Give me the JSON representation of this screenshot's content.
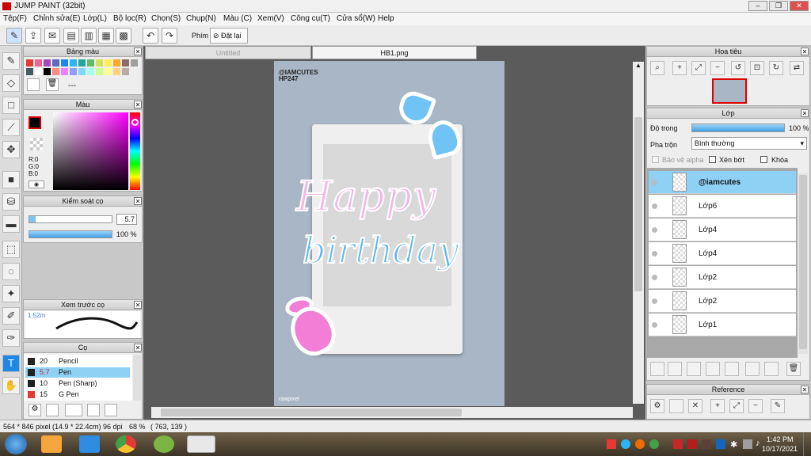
{
  "window": {
    "title": "JUMP PAINT (32bit)"
  },
  "menu": [
    "Tệp(F)",
    "Chỉnh sửa(E)",
    "Lớp(L)",
    "Bộ lọc(R)",
    "Chọn(S)",
    "Chụp(N)",
    "Màu (C)",
    "Xem(V)",
    "Công cụ(T)",
    "Cửa sổ(W)",
    "Help"
  ],
  "toolbar": {
    "phim_label": "Phím",
    "reset_label": "Đặt lại"
  },
  "tabs": {
    "untitled": "Untitled",
    "active": "HB1.png"
  },
  "palette": {
    "title": "Bảng màu",
    "name": "---",
    "colors": [
      "#e53935",
      "#f06292",
      "#ab47bc",
      "#5c6bc0",
      "#1e88e5",
      "#29b6f6",
      "#26a69a",
      "#66bb6a",
      "#d4e157",
      "#ffee58",
      "#ffa726",
      "#8d6e63",
      "#9e9e9e",
      "#455a64",
      "#ffffff",
      "#000000",
      "#ff8a80",
      "#ea80fc",
      "#8c9eff",
      "#80d8ff",
      "#a7ffeb",
      "#ccff90",
      "#ffff8d",
      "#ffd180",
      "#bcaaa4",
      "#eeeeee"
    ]
  },
  "color_panel": {
    "title": "Màu",
    "r": "R:0",
    "g": "G:0",
    "b": "B:0"
  },
  "brush_control": {
    "title": "Kiểm soát cọ",
    "size": "5.7",
    "opacity": "100 %",
    "opacity_value": 1.0
  },
  "brush_preview": {
    "title": "Xem trước cọ",
    "size": "1.52m"
  },
  "brush": {
    "title": "Cọ",
    "items": [
      {
        "size": "20",
        "name": "Pencil",
        "color": "#222222",
        "selected": false
      },
      {
        "size": "5.7",
        "name": "Pen",
        "color": "#222222",
        "selected": true
      },
      {
        "size": "10",
        "name": "Pen (Sharp)",
        "color": "#222222",
        "selected": false
      },
      {
        "size": "15",
        "name": "G Pen",
        "color": "#e53935",
        "selected": false
      }
    ]
  },
  "canvas": {
    "credit1": "@IAMCUTES",
    "credit2": "HP247",
    "word1": "Happy",
    "word2": "birthday",
    "watermark": "rawpixel"
  },
  "navigator": {
    "title": "Hoa tiêu"
  },
  "layer_panel": {
    "title": "Lớp",
    "opacity_label": "Độ trong",
    "opacity_value": "100 %",
    "opacity_fraction": 1.0,
    "blend_label": "Pha trộn",
    "blend_mode": "Bình thường",
    "protect_alpha": "Bảo vệ alpha",
    "clip": "Xén bớt",
    "lock": "Khóa",
    "layers": [
      {
        "name": "@iamcutes",
        "selected": true
      },
      {
        "name": "Lớp6",
        "selected": false
      },
      {
        "name": "Lớp4",
        "selected": false
      },
      {
        "name": "Lớp4",
        "selected": false
      },
      {
        "name": "Lớp2",
        "selected": false
      },
      {
        "name": "Lớp2",
        "selected": false
      },
      {
        "name": "Lớp1",
        "selected": false
      }
    ]
  },
  "reference": {
    "title": "Reference"
  },
  "status": {
    "pixels": "564 * 846 pixel",
    "cm": "(14.9 * 22.4cm)",
    "dpi": "96 dpi",
    "zoom": "68 %",
    "coords": "( 763, 139 )"
  },
  "taskbar": {
    "time": "1:42 PM",
    "date": "10/17/2021"
  }
}
